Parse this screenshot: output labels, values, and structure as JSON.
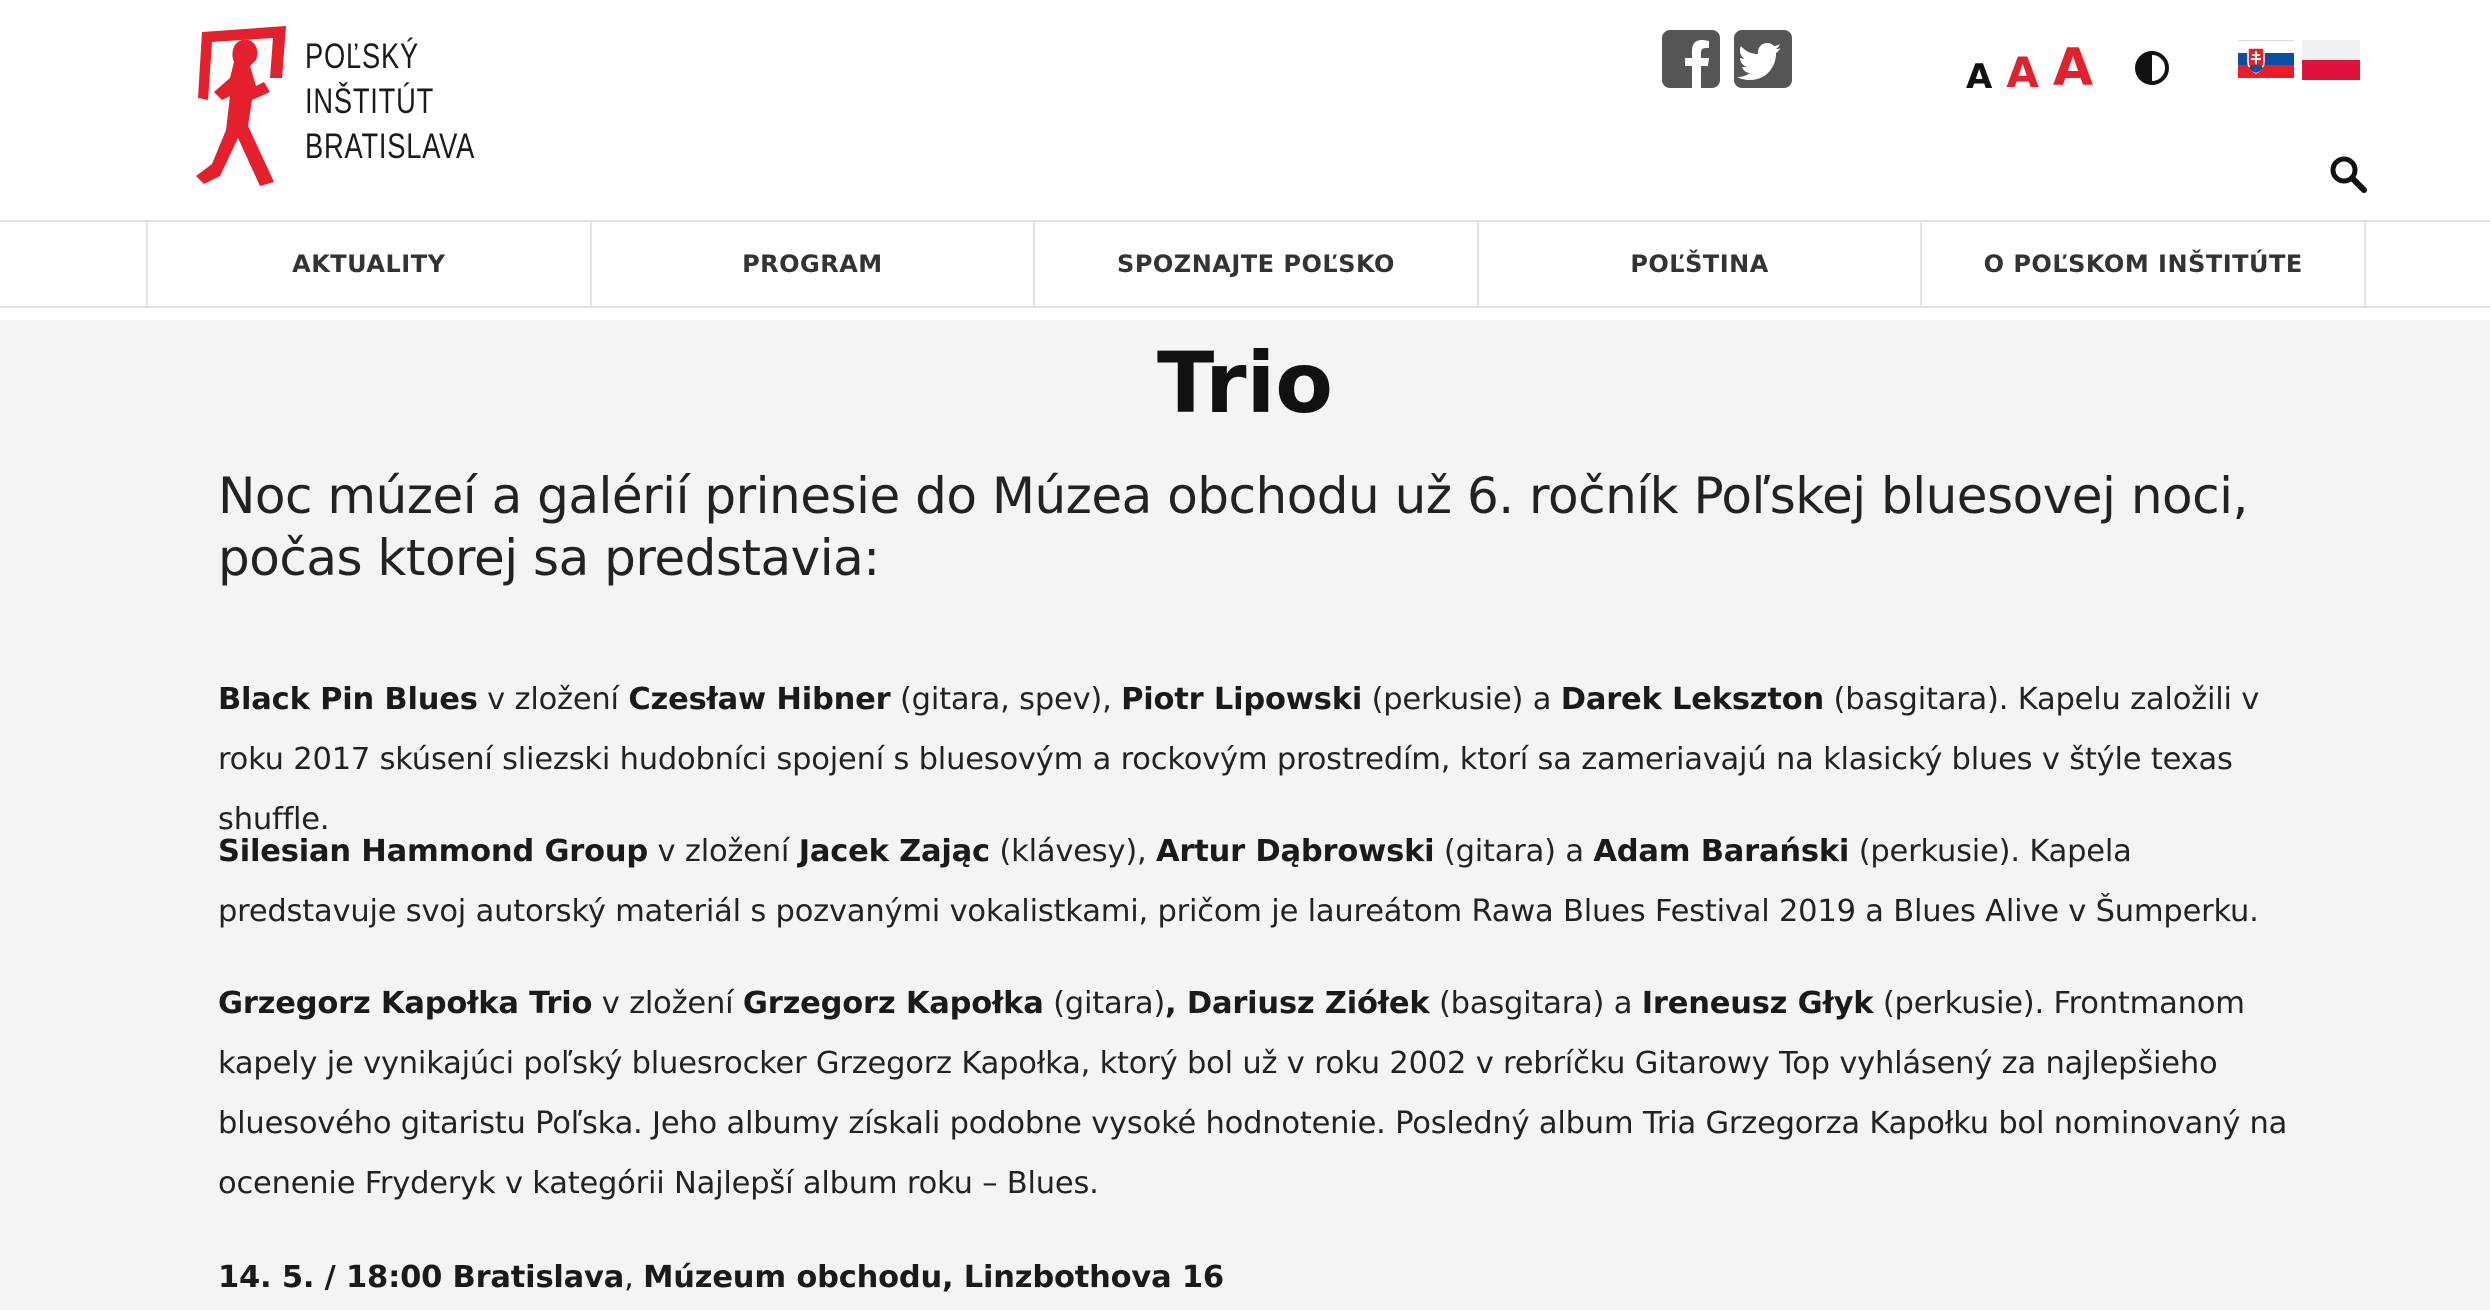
{
  "header": {
    "logo": {
      "line1": "POĽSKÝ",
      "line2": "INŠTITÚT",
      "line3": "BRATISLAVA"
    },
    "font_sizes": [
      "A",
      "A",
      "A"
    ],
    "icons": {
      "facebook": "facebook-icon",
      "twitter": "twitter-icon",
      "contrast": "contrast-icon",
      "search": "search-icon",
      "flag_sk": "slovak-flag-icon",
      "flag_pl": "polish-flag-icon"
    },
    "colors": {
      "accent": "#e3202c"
    }
  },
  "nav": {
    "items": [
      {
        "label": "AKTUALITY"
      },
      {
        "label": "PROGRAM"
      },
      {
        "label": "SPOZNAJTE POĽSKO"
      },
      {
        "label": "POĽŠTINA"
      },
      {
        "label": "O POĽSKOM INŠTITÚTE"
      }
    ]
  },
  "article": {
    "title": "Trio",
    "lead": "Noc múzeí a galérií prinesie do Múzea obchodu už 6. ročník Poľskej bluesovej noci, počas ktorej sa predstavia:",
    "p1": {
      "band": "Black Pin Blues",
      "t1": " v zložení ",
      "m1": "Czesław Hibner",
      "t2": " (gitara, spev), ",
      "m2": "Piotr Lipowski",
      "t3": " (perkusie) a ",
      "m3": "Darek Lekszton",
      "t4": " (basgitara). Kapelu založili v roku 2017 skúsení sliezski hudobníci spojení s bluesovým a rockovým prostredím, ktorí sa zameriavajú na klasický blues v štýle texas shuffle."
    },
    "p2": {
      "band": "Silesian Hammond Group",
      "t1": " v zložení ",
      "m1": "Jacek Zając",
      "t2": " (klávesy), ",
      "m2": "Artur Dąbrowski",
      "t3": " (gitara) a ",
      "m3": "Adam Barański",
      "t4": " (perkusie). Kapela predstavuje svoj autorský materiál s pozvanými vokalistkami, pričom je laureátom Rawa Blues Festival 2019 a Blues Alive v Šumperku."
    },
    "p3": {
      "band": "Grzegorz Kapołka Trio",
      "t1": " v zložení ",
      "m1": "Grzegorz Kapołka",
      "t2": " (gitara)",
      "m2": ", Dariusz Ziółek",
      "t3": " (basgitara) a ",
      "m3": "Ireneusz Głyk",
      "t4": " (perkusie). Frontmanom kapely je vynikajúci poľský bluesrocker Grzegorz Kapołka, ktorý bol už v roku 2002 v rebríčku Gitarowy Top vyhlásený za najlepšieho bluesového gitaristu Poľska. Jeho albumy získali podobne vysoké hodnotenie. Posledný album Tria Grzegorza Kapołku bol nominovaný na ocenenie Fryderyk v kategórii Najlepší album roku – Blues."
    },
    "event": {
      "date": "14. 5. / 18:00 Bratislava",
      "sep": ", ",
      "venue": "Múzeum obchodu, Linzbothova 16"
    }
  }
}
